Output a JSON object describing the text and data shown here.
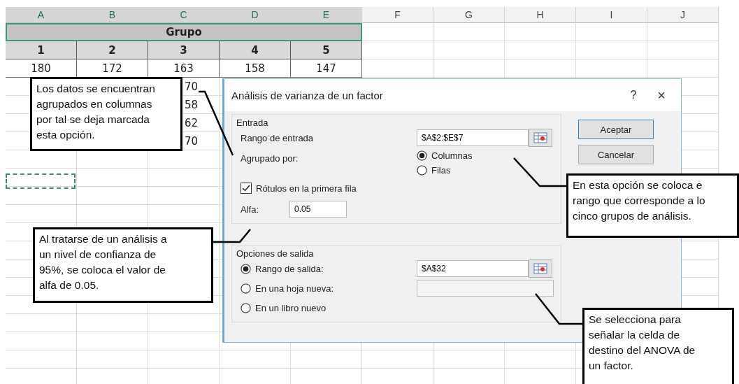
{
  "spreadsheet": {
    "columns": [
      {
        "label": "A",
        "selected": true
      },
      {
        "label": "B",
        "selected": true
      },
      {
        "label": "C",
        "selected": true
      },
      {
        "label": "D",
        "selected": true
      },
      {
        "label": "E",
        "selected": true
      },
      {
        "label": "F",
        "selected": false
      },
      {
        "label": "G",
        "selected": false
      },
      {
        "label": "H",
        "selected": false
      },
      {
        "label": "I",
        "selected": false
      },
      {
        "label": "J",
        "selected": false
      }
    ],
    "merged_header": "Grupo",
    "header_row": [
      "1",
      "2",
      "3",
      "4",
      "5"
    ],
    "first_row": [
      "180",
      "172",
      "163",
      "158",
      "147"
    ],
    "column_c_visible": [
      "70",
      "58",
      "62",
      "70"
    ]
  },
  "dialog": {
    "title": "Análisis de varianza de un factor",
    "help": "?",
    "close": "×",
    "input": {
      "legend": "Entrada",
      "range_label": "Rango de entrada",
      "range_value": "$A$2:$E$7",
      "grouped_label": "Agrupado por:",
      "grouped_options": [
        {
          "label": "Columnas",
          "selected": true
        },
        {
          "label": "Filas",
          "selected": false
        }
      ],
      "labels_checkbox": {
        "label": "Rótulos en la primera fila",
        "checked": true
      },
      "alpha_label": "Alfa:",
      "alpha_value": "0.05"
    },
    "output": {
      "legend": "Opciones de salida",
      "options": [
        {
          "label": "Rango de salida:",
          "selected": true,
          "value": "$A$32"
        },
        {
          "label": "En una hoja nueva:",
          "selected": false,
          "field": true
        },
        {
          "label": "En un libro nuevo",
          "selected": false
        }
      ]
    },
    "buttons": [
      "Aceptar",
      "Cancelar"
    ]
  },
  "callouts": [
    {
      "lines": [
        "Los datos se encuentran",
        "agrupados en columnas",
        "por tal se deja marcada",
        "esta opción."
      ]
    },
    {
      "lines": [
        "Al tratarse de un análisis a",
        "un nivel de confianza de",
        "95%, se coloca el valor de",
        "alfa de 0.05."
      ]
    },
    {
      "lines": [
        "En esta opción se coloca e",
        "rango que corresponde a lo",
        "cinco grupos de análisis."
      ]
    },
    {
      "lines": [
        "Se selecciona para",
        "señalar la celda de",
        "destino del ANOVA de",
        "un factor."
      ]
    }
  ]
}
